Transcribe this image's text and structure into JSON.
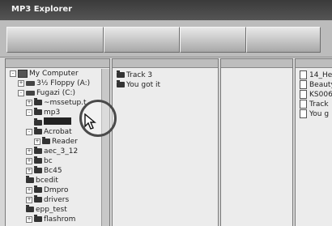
{
  "app": {
    "title": "MP3 Explorer"
  },
  "tree": [
    {
      "label": "My Computer",
      "kind": "computer",
      "indent": 0,
      "expander": "-"
    },
    {
      "label": "3½ Floppy (A:)",
      "kind": "drive",
      "indent": 1,
      "expander": "+"
    },
    {
      "label": "Fugazi (C:)",
      "kind": "drive",
      "indent": 1,
      "expander": "-"
    },
    {
      "label": "~mssetup.t",
      "kind": "folder",
      "indent": 2,
      "expander": "+"
    },
    {
      "label": "mp3",
      "kind": "folder",
      "indent": 2,
      "expander": "-"
    },
    {
      "label": "",
      "kind": "folder",
      "indent": 3,
      "expander": "",
      "selected": true
    },
    {
      "label": "Acrobat",
      "kind": "folder",
      "indent": 2,
      "expander": "-"
    },
    {
      "label": "Reader",
      "kind": "folder",
      "indent": 3,
      "expander": "+"
    },
    {
      "label": "aec_3_12",
      "kind": "folder",
      "indent": 2,
      "expander": "+"
    },
    {
      "label": "bc",
      "kind": "folder",
      "indent": 2,
      "expander": "+"
    },
    {
      "label": "Bc45",
      "kind": "folder",
      "indent": 2,
      "expander": "+"
    },
    {
      "label": "bcedit",
      "kind": "folder",
      "indent": 2,
      "expander": ""
    },
    {
      "label": "Dmpro",
      "kind": "folder",
      "indent": 2,
      "expander": "+"
    },
    {
      "label": "drivers",
      "kind": "folder",
      "indent": 2,
      "expander": "+"
    },
    {
      "label": "epp_test",
      "kind": "folder",
      "indent": 2,
      "expander": ""
    },
    {
      "label": "flashrom",
      "kind": "folder",
      "indent": 2,
      "expander": "+"
    }
  ],
  "tracks_pane": [
    {
      "label": "Track  3"
    },
    {
      "label": "You got it"
    }
  ],
  "files_pane": [
    {
      "label": "14_He"
    },
    {
      "label": "Beauty"
    },
    {
      "label": "KS006"
    },
    {
      "label": "Track"
    },
    {
      "label": "You g"
    }
  ]
}
